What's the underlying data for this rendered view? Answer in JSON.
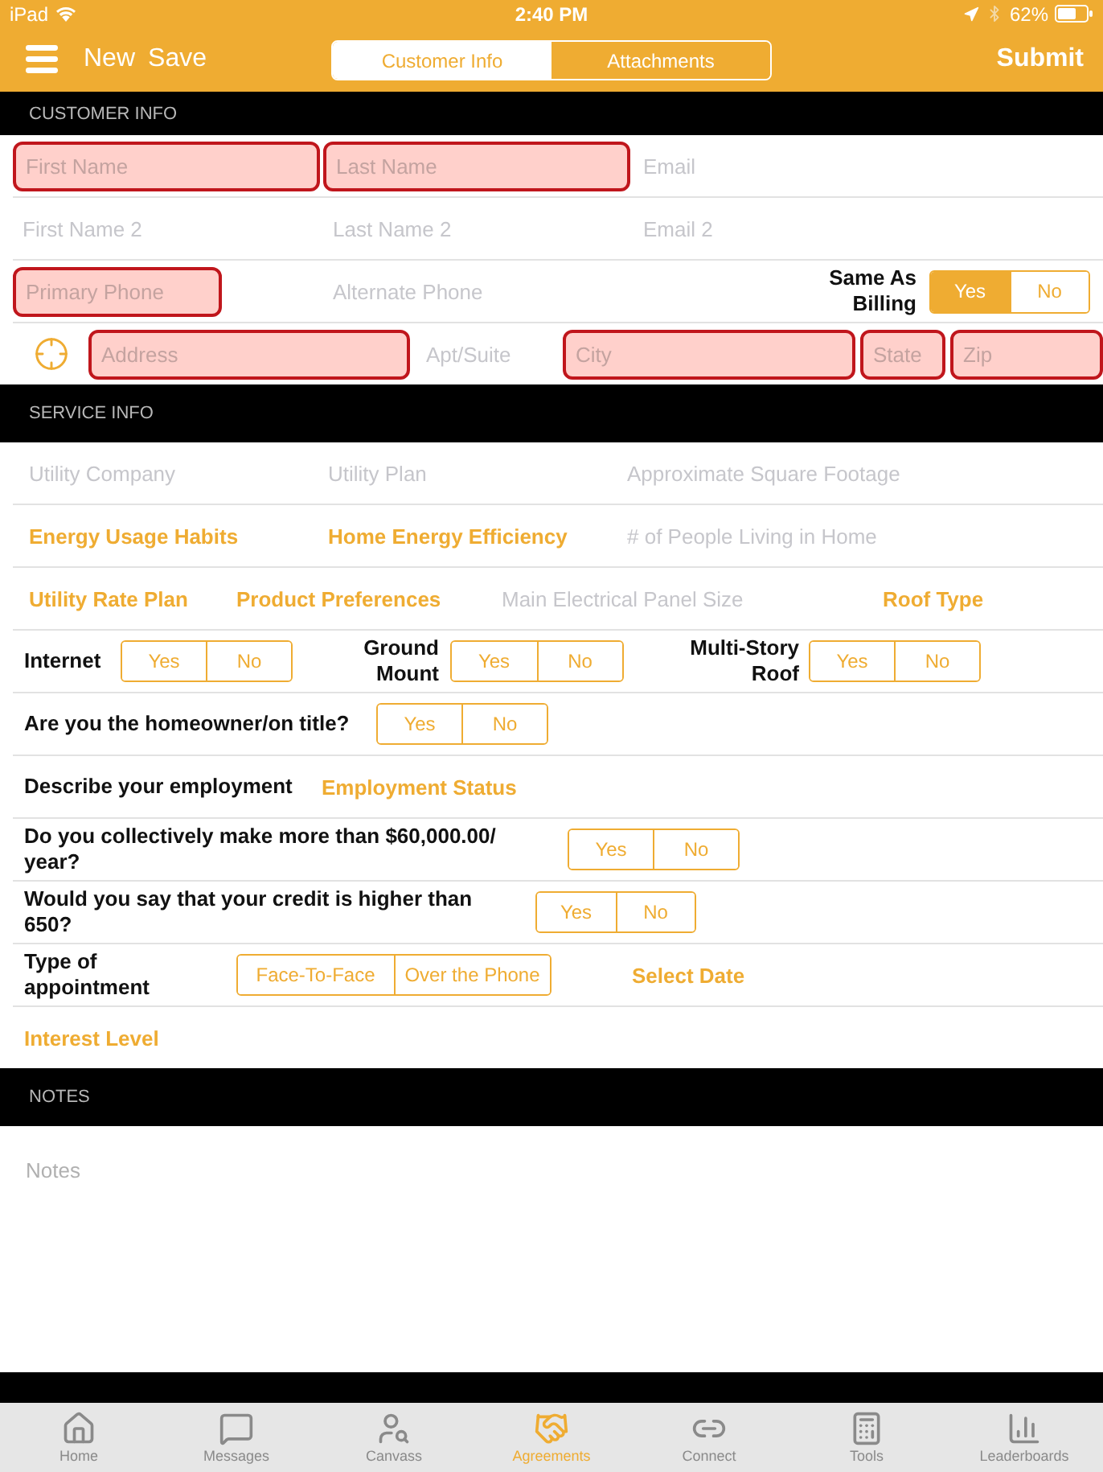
{
  "status_bar": {
    "carrier": "iPad",
    "time": "2:40 PM",
    "battery": "62%"
  },
  "nav": {
    "actions": [
      "New",
      "Save"
    ],
    "segments": [
      {
        "label": "Customer Info",
        "selected": true
      },
      {
        "label": "Attachments",
        "selected": false
      }
    ],
    "submit": "Submit"
  },
  "sections": [
    {
      "title": "CUSTOMER INFO",
      "rows": [
        {
          "items": [
            {
              "kind": "field",
              "placeholder": "First Name",
              "invalid": true
            },
            {
              "kind": "field",
              "placeholder": "Last Name",
              "invalid": true
            },
            {
              "kind": "field",
              "placeholder": "Email",
              "invalid": false
            }
          ]
        },
        {
          "items": [
            {
              "kind": "field",
              "placeholder": "First Name 2",
              "invalid": false
            },
            {
              "kind": "field",
              "placeholder": "Last Name 2",
              "invalid": false
            },
            {
              "kind": "field",
              "placeholder": "Email 2",
              "invalid": false
            }
          ]
        },
        {
          "items": [
            {
              "kind": "field",
              "placeholder": "Primary Phone",
              "invalid": true
            },
            {
              "kind": "field",
              "placeholder": "Alternate Phone",
              "invalid": false
            },
            {
              "kind": "label",
              "text": "Same As Billing"
            },
            {
              "kind": "toggle",
              "options": [
                {
                  "label": "Yes",
                  "selected": true
                },
                {
                  "label": "No",
                  "selected": false
                }
              ]
            }
          ]
        },
        {
          "items": [
            {
              "kind": "locate"
            },
            {
              "kind": "field",
              "placeholder": "Address",
              "invalid": true
            },
            {
              "kind": "field",
              "placeholder": "Apt/Suite",
              "invalid": false
            },
            {
              "kind": "field",
              "placeholder": "City",
              "invalid": true
            },
            {
              "kind": "field",
              "placeholder": "State",
              "invalid": true
            },
            {
              "kind": "field",
              "placeholder": "Zip",
              "invalid": true
            }
          ]
        }
      ]
    },
    {
      "title": "SERVICE INFO",
      "rows": [
        {
          "items": [
            {
              "kind": "field",
              "placeholder": "Utility Company",
              "invalid": false
            },
            {
              "kind": "field",
              "placeholder": "Utility Plan",
              "invalid": false
            },
            {
              "kind": "field",
              "placeholder": "Approximate Square Footage",
              "invalid": false
            }
          ]
        },
        {
          "items": [
            {
              "kind": "picker",
              "text": "Energy Usage Habits"
            },
            {
              "kind": "picker",
              "text": "Home Energy Efficiency"
            },
            {
              "kind": "field",
              "placeholder": "# of People Living in Home",
              "invalid": false
            }
          ]
        },
        {
          "items": [
            {
              "kind": "picker",
              "text": "Utility Rate Plan"
            },
            {
              "kind": "picker",
              "text": "Product Preferences"
            },
            {
              "kind": "field",
              "placeholder": "Main Electrical Panel Size",
              "invalid": false
            },
            {
              "kind": "picker",
              "text": "Roof Type"
            }
          ]
        },
        {
          "items": [
            {
              "kind": "label",
              "text": "Internet"
            },
            {
              "kind": "toggle",
              "options": [
                {
                  "label": "Yes",
                  "selected": false
                },
                {
                  "label": "No",
                  "selected": false
                }
              ]
            },
            {
              "kind": "label",
              "text": "Ground Mount"
            },
            {
              "kind": "toggle",
              "options": [
                {
                  "label": "Yes",
                  "selected": false
                },
                {
                  "label": "No",
                  "selected": false
                }
              ]
            },
            {
              "kind": "label",
              "text": "Multi-Story Roof"
            },
            {
              "kind": "toggle",
              "options": [
                {
                  "label": "Yes",
                  "selected": false
                },
                {
                  "label": "No",
                  "selected": false
                }
              ]
            }
          ]
        },
        {
          "items": [
            {
              "kind": "label",
              "text": "Are you the homeowner/on title?"
            },
            {
              "kind": "toggle",
              "options": [
                {
                  "label": "Yes",
                  "selected": false
                },
                {
                  "label": "No",
                  "selected": false
                }
              ]
            }
          ]
        },
        {
          "items": [
            {
              "kind": "label",
              "text": "Describe your employment"
            },
            {
              "kind": "picker",
              "text": "Employment Status"
            }
          ]
        },
        {
          "items": [
            {
              "kind": "label",
              "text": "Do you collectively make more than $60,000.00/ year?"
            },
            {
              "kind": "toggle",
              "options": [
                {
                  "label": "Yes",
                  "selected": false
                },
                {
                  "label": "No",
                  "selected": false
                }
              ]
            }
          ]
        },
        {
          "items": [
            {
              "kind": "label",
              "text": "Would you say that your credit is higher than 650?"
            },
            {
              "kind": "toggle",
              "options": [
                {
                  "label": "Yes",
                  "selected": false
                },
                {
                  "label": "No",
                  "selected": false
                }
              ]
            }
          ]
        },
        {
          "items": [
            {
              "kind": "label",
              "text": "Type of appointment"
            },
            {
              "kind": "toggle",
              "options": [
                {
                  "label": "Face-To-Face",
                  "selected": false
                },
                {
                  "label": "Over the Phone",
                  "selected": false
                }
              ]
            },
            {
              "kind": "picker",
              "text": "Select Date"
            }
          ]
        },
        {
          "items": [
            {
              "kind": "picker",
              "text": "Interest Level"
            }
          ]
        }
      ]
    },
    {
      "title": "NOTES",
      "rows": [
        {
          "items": [
            {
              "kind": "notes",
              "placeholder": "Notes"
            }
          ]
        }
      ]
    }
  ],
  "tab_bar": [
    {
      "label": "Home",
      "selected": false
    },
    {
      "label": "Messages",
      "selected": false
    },
    {
      "label": "Canvass",
      "selected": false
    },
    {
      "label": "Agreements",
      "selected": true
    },
    {
      "label": "Connect",
      "selected": false
    },
    {
      "label": "Tools",
      "selected": false
    },
    {
      "label": "Leaderboards",
      "selected": false
    }
  ]
}
